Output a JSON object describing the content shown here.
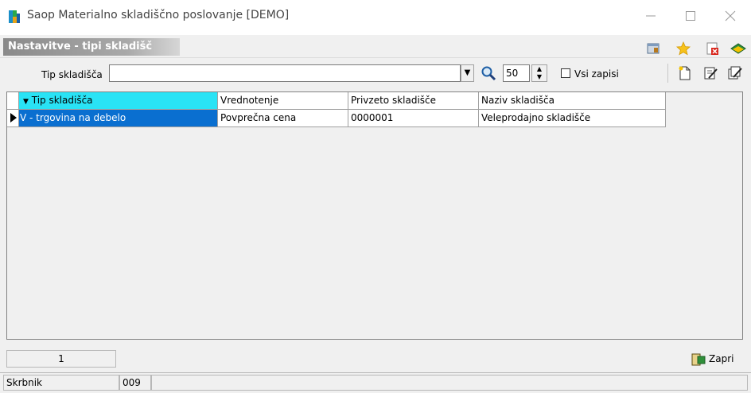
{
  "window": {
    "title": "Saop Materialno skladiščno poslovanje [DEMO]",
    "controls": [
      "minimize-icon",
      "maximize-icon",
      "close-icon"
    ]
  },
  "header": {
    "title": "Nastavitve - tipi skladišč",
    "icons": [
      "window-icon",
      "star-icon",
      "close-document-icon",
      "help-book-icon"
    ]
  },
  "toolbar": {
    "filter_label": "Tip skladišča",
    "filter_value": "",
    "record_limit": "50",
    "all_records_label": "Vsi zapisi",
    "all_records_checked": false,
    "action_icons": [
      "new-record-icon",
      "edit-record-icon",
      "edit-multiple-icon"
    ]
  },
  "grid": {
    "columns": [
      "Tip skladišča",
      "Vrednotenje",
      "Privzeto skladišče",
      "Naziv skladišča"
    ],
    "rows": [
      [
        "V - trgovina na debelo",
        "Povprečna cena",
        "0000001",
        "Veleprodajno skladišče"
      ]
    ],
    "selected_row": 0,
    "sort_column": 0
  },
  "footer": {
    "page": "1",
    "close_label": "Zapri"
  },
  "statusbar": {
    "user": "Skrbnik",
    "code": "009",
    "rest": ""
  },
  "colors": {
    "sorted_header": "#29e3f5",
    "selection": "#0a6fd0",
    "header_gradient_start": "#8a8a8a"
  }
}
